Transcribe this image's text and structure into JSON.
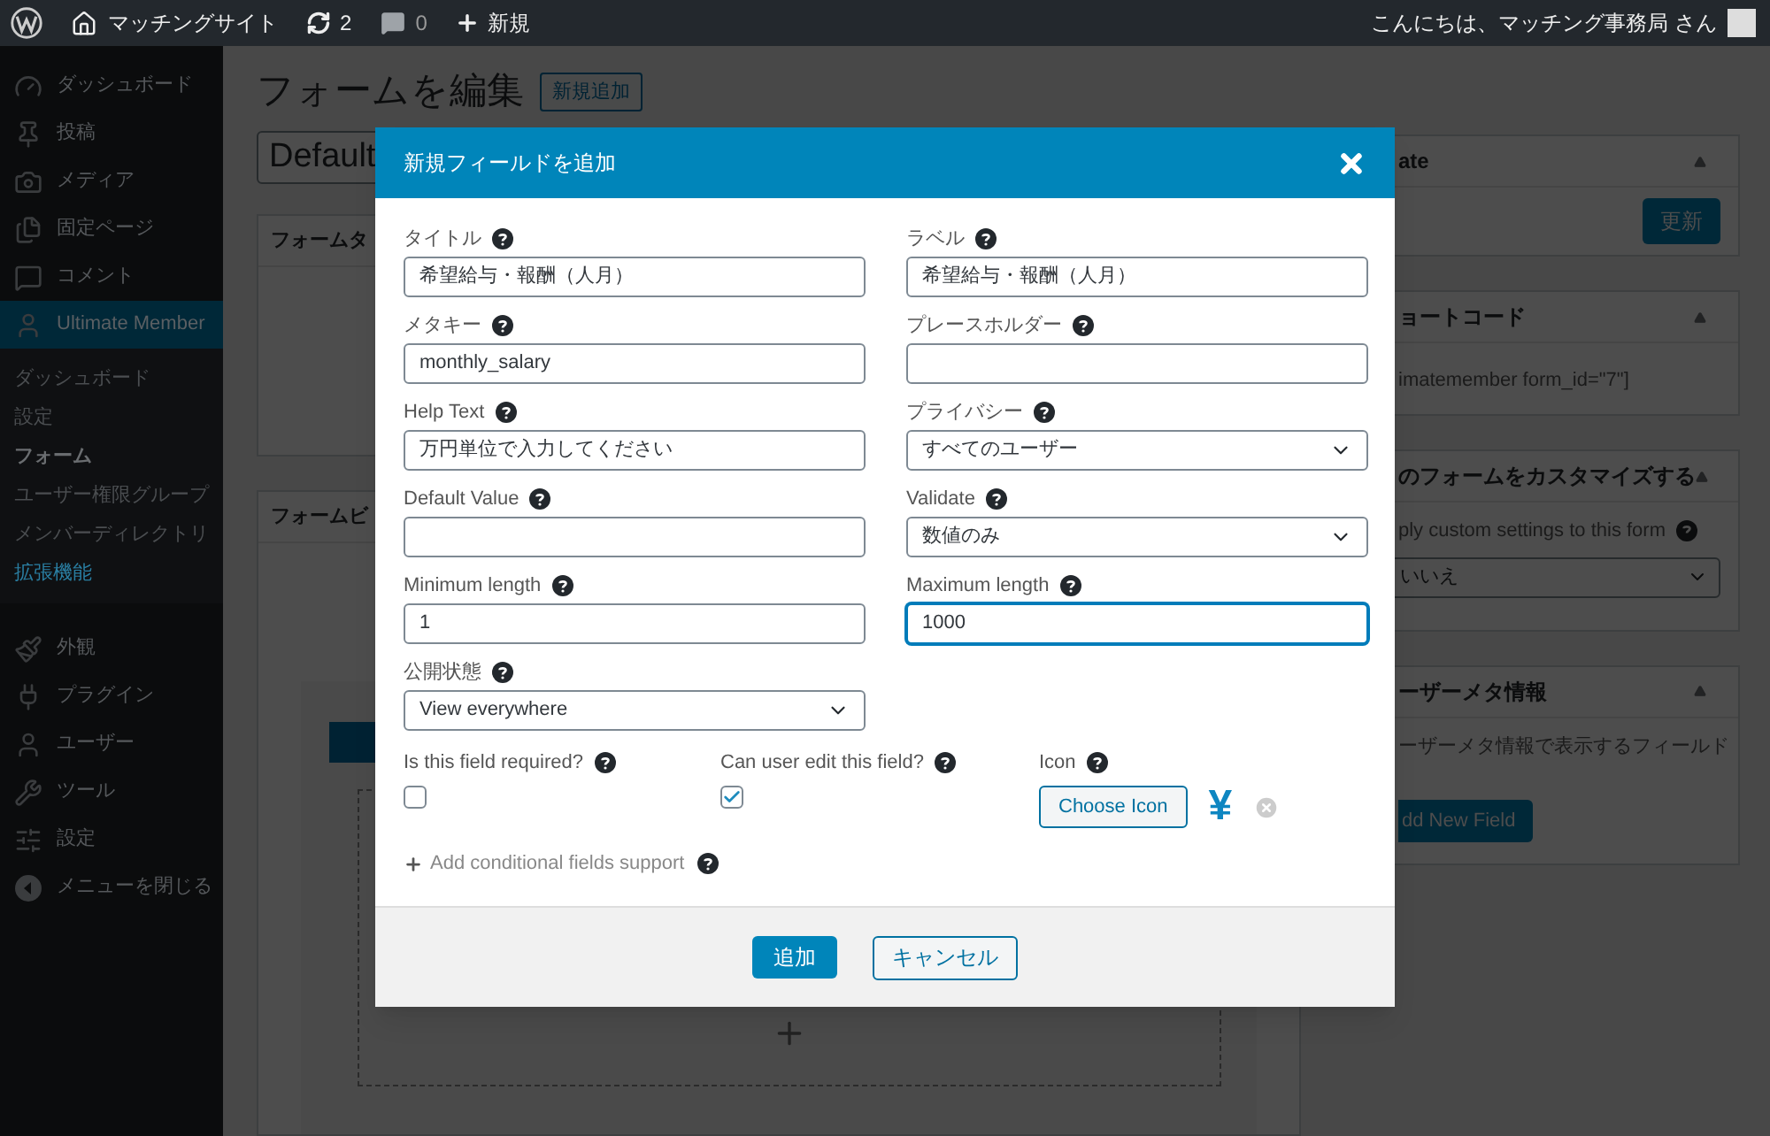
{
  "admin_bar": {
    "items": [
      {
        "kind": "logo"
      },
      {
        "kind": "site",
        "label": "マッチングサイト"
      },
      {
        "kind": "updates",
        "label": "2"
      },
      {
        "kind": "comments",
        "label": "0"
      },
      {
        "kind": "new",
        "label": "新規"
      }
    ],
    "greeting": "こんにちは、マッチング事務局 さん"
  },
  "sidebar": {
    "items": [
      {
        "kind": "dashboard",
        "label": "ダッシュボード",
        "selected": false
      },
      {
        "kind": "posts",
        "label": "投稿",
        "selected": false
      },
      {
        "kind": "media",
        "label": "メディア",
        "selected": false
      },
      {
        "kind": "pages",
        "label": "固定ページ",
        "selected": false
      },
      {
        "kind": "comments",
        "label": "コメント",
        "selected": false
      },
      {
        "kind": "member",
        "label": "Ultimate Member",
        "selected": true,
        "children": [
          {
            "label": "ダッシュボード",
            "selected": false,
            "highlighted": false
          },
          {
            "label": "設定",
            "selected": false,
            "highlighted": false
          },
          {
            "label": "フォーム",
            "selected": true,
            "highlighted": false
          },
          {
            "label": "ユーザー権限グループ",
            "selected": false,
            "highlighted": false
          },
          {
            "label": "メンバーディレクトリ",
            "selected": false,
            "highlighted": false
          },
          {
            "label": "拡張機能",
            "selected": false,
            "highlighted": true
          }
        ]
      },
      {
        "kind": "appearance",
        "label": "外観",
        "selected": false
      },
      {
        "kind": "plugins",
        "label": "プラグイン",
        "selected": false
      },
      {
        "kind": "users",
        "label": "ユーザー",
        "selected": false
      },
      {
        "kind": "tools",
        "label": "ツール",
        "selected": false
      },
      {
        "kind": "settings",
        "label": "設定",
        "selected": false
      },
      {
        "kind": "collapse",
        "label": "メニューを閉じる",
        "selected": false
      }
    ]
  },
  "page": {
    "title": "フォームを編集",
    "add_new": "新規追加",
    "form_title": "Default",
    "left_panels": [
      {
        "title": "フォームタ"
      },
      {
        "title": "フォームビ"
      }
    ],
    "right_panels": [
      {
        "kind": "publish",
        "title": "ate",
        "button": "更新"
      },
      {
        "kind": "text",
        "title": "ョートコード",
        "text": "imatemember form_id=\"7\"]"
      },
      {
        "kind": "select",
        "title": "のフォームをカスタマイズする",
        "text": "ply custom settings to this form",
        "value": "いいえ"
      },
      {
        "kind": "button",
        "title": "ーザーメタ情報",
        "text": "ーザーメタ情報で表示するフィールド",
        "button": "dd New Field"
      }
    ]
  },
  "modal": {
    "title": "新規フィールドを追加",
    "fields": [
      {
        "kind": "text",
        "label": "タイトル",
        "value": "希望給与・報酬（人月）",
        "focused": false
      },
      {
        "kind": "text",
        "label": "ラベル",
        "value": "希望給与・報酬（人月）",
        "focused": false
      },
      {
        "kind": "text",
        "label": "メタキー",
        "value": "monthly_salary",
        "focused": false
      },
      {
        "kind": "text",
        "label": "プレースホルダー",
        "focused": false
      },
      {
        "kind": "text",
        "label": "Help Text",
        "value": "万円単位で入力してください",
        "focused": false
      },
      {
        "kind": "select",
        "label": "プライバシー",
        "value": "すべてのユーザー",
        "focused": false
      },
      {
        "kind": "text",
        "label": "Default Value",
        "focused": false
      },
      {
        "kind": "select",
        "label": "Validate",
        "value": "数値のみ",
        "focused": false
      },
      {
        "kind": "text",
        "label": "Minimum length",
        "value": "1",
        "focused": false
      },
      {
        "kind": "text",
        "label": "Maximum length",
        "value": "1000",
        "focused": true
      },
      {
        "kind": "select",
        "label": "公開状態",
        "value": "View everywhere",
        "focused": false
      }
    ],
    "options": [
      {
        "kind": "checkbox",
        "label": "Is this field required?",
        "checked": false
      },
      {
        "kind": "checkbox",
        "label": "Can user edit this field?",
        "checked": true
      },
      {
        "kind": "icon",
        "label": "Icon",
        "button": "Choose Icon",
        "glyph": "¥"
      }
    ],
    "conditional_link": "Add conditional fields support",
    "buttons": [
      {
        "kind": "primary",
        "label": "追加"
      },
      {
        "kind": "secondary",
        "label": "キャンセル"
      }
    ]
  }
}
